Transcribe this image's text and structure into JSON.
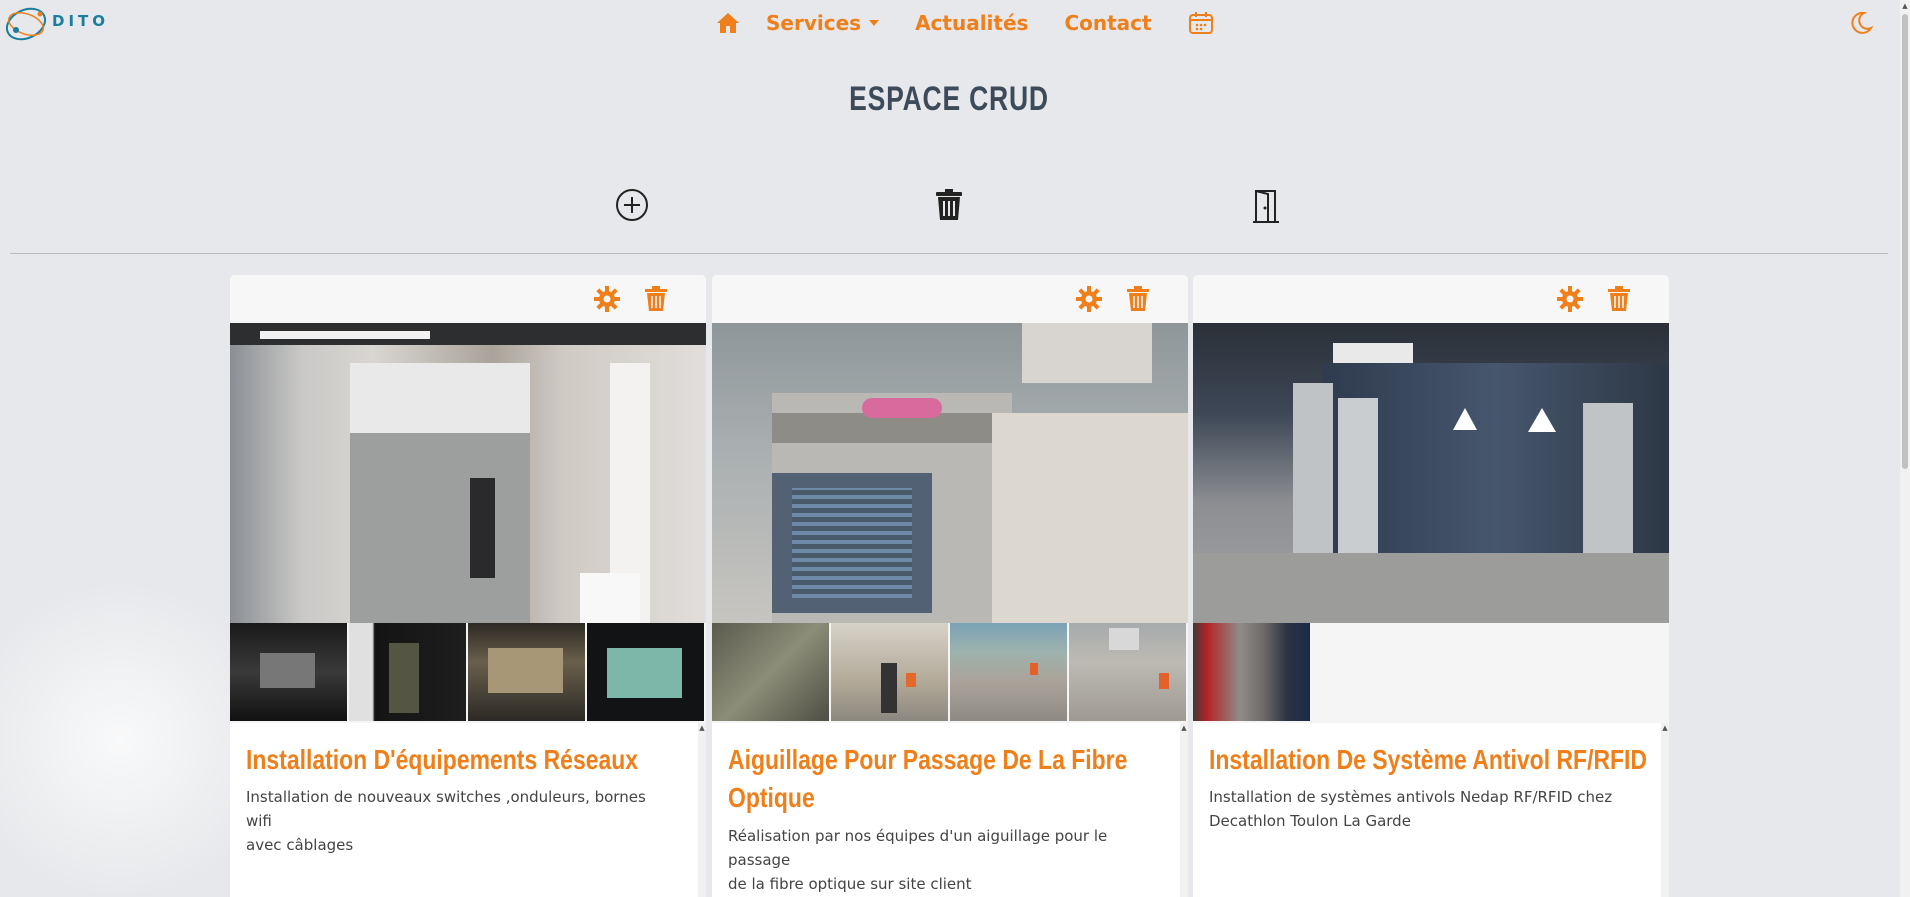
{
  "nav": {
    "logo_text": "DITO",
    "services_label": "Services",
    "news_label": "Actualités",
    "contact_label": "Contact"
  },
  "page_title": "ESPACE CRUD",
  "toolbar": {
    "add_icon": "plus-circle-icon",
    "delete_icon": "trash-icon",
    "logout_icon": "door-icon"
  },
  "colors": {
    "accent": "#ef7f1a",
    "title": "#3d4a5a",
    "background": "#e6e8eb"
  },
  "cards": [
    {
      "title_lines": [
        "Installation D'équipements Réseaux"
      ],
      "description_lines": [
        "Installation de nouveaux switches ,onduleurs, bornes wifi",
        "avec câblages"
      ],
      "thumbnail_count": 4
    },
    {
      "title_lines": [
        "Aiguillage Pour Passage De La Fibre",
        "Optique"
      ],
      "description_lines": [
        "Réalisation par nos équipes d'un aiguillage pour le passage",
        "de la fibre optique sur site client"
      ],
      "thumbnail_count": 4
    },
    {
      "title_lines": [
        "Installation De Système Antivol RF/RFID"
      ],
      "description_lines": [
        "Installation de systèmes antivols Nedap RF/RFID chez",
        "Decathlon Toulon La Garde"
      ],
      "thumbnail_count": 1
    }
  ]
}
